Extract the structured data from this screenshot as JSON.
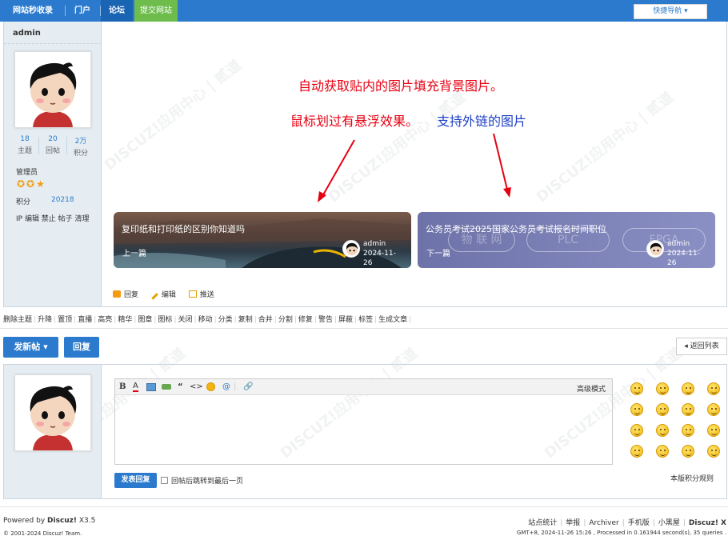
{
  "topnav": {
    "site_name": "网站秒收录",
    "items": [
      "门户",
      "论坛",
      "提交网站"
    ],
    "quicknav": "快捷导航 ▾"
  },
  "author": {
    "name": "admin",
    "stats": [
      {
        "value": "18",
        "label": "主题"
      },
      {
        "value": "20",
        "label": "回帖"
      },
      {
        "value": "2万",
        "label": "积分"
      }
    ],
    "role": "管理员",
    "stars": "✪✪★",
    "credit_label": "积分",
    "credit_value": "20218",
    "links": "IP 编辑 禁止 帖子 清理"
  },
  "annotations": {
    "line1": "自动获取贴内的图片填充背景图片。",
    "line2_red": "鼠标划过有悬浮效果。",
    "line2_blue": "支持外链的图片"
  },
  "prev_card": {
    "title": "复印纸和打印纸的区别你知道吗",
    "nav": "上一篇",
    "author": "admin",
    "date": "2024-11-26"
  },
  "next_card": {
    "title": "公务员考试2025国家公务员考试报名时间职位",
    "nav": "下一篇",
    "author": "admin",
    "date": "2024-11-26",
    "bg_words": [
      "物 联 网",
      "PLC",
      "FPGA"
    ]
  },
  "post_actions": [
    "回复",
    "编辑",
    "推送"
  ],
  "modbar": [
    "删除主题",
    "升降",
    "置顶",
    "直播",
    "高亮",
    "精华",
    "图章",
    "图标",
    "关闭",
    "移动",
    "分类",
    "复制",
    "合并",
    "分割",
    "修复",
    "警告",
    "屏蔽",
    "标签",
    "生成文章"
  ],
  "buttons": {
    "new_post": "发新帖 ▾",
    "reply": "回复",
    "back_list": "◂ 返回列表"
  },
  "editor": {
    "advanced": "高级模式",
    "submit": "发表回复",
    "jump_label": "回帖后跳转到最后一页",
    "rules": "本版积分规则"
  },
  "footer": {
    "powered_prefix": "Powered by ",
    "powered_name": "Discuz!",
    "powered_ver": " X3.5",
    "copyright": "© 2001-2024 Discuz! Team.",
    "links": [
      "站点统计",
      "举报",
      "Archiver",
      "手机版",
      "小黑屋"
    ],
    "brand": "Discuz! X",
    "stats": "GMT+8, 2024-11-26 15:26 , Processed in 0.161944 second(s), 35 queries ."
  },
  "colors": {
    "nav_blue": "#2b7acd",
    "nav_green": "#6dbc4c",
    "annotation_red": "#e60012",
    "annotation_blue": "#1d3fc6"
  }
}
